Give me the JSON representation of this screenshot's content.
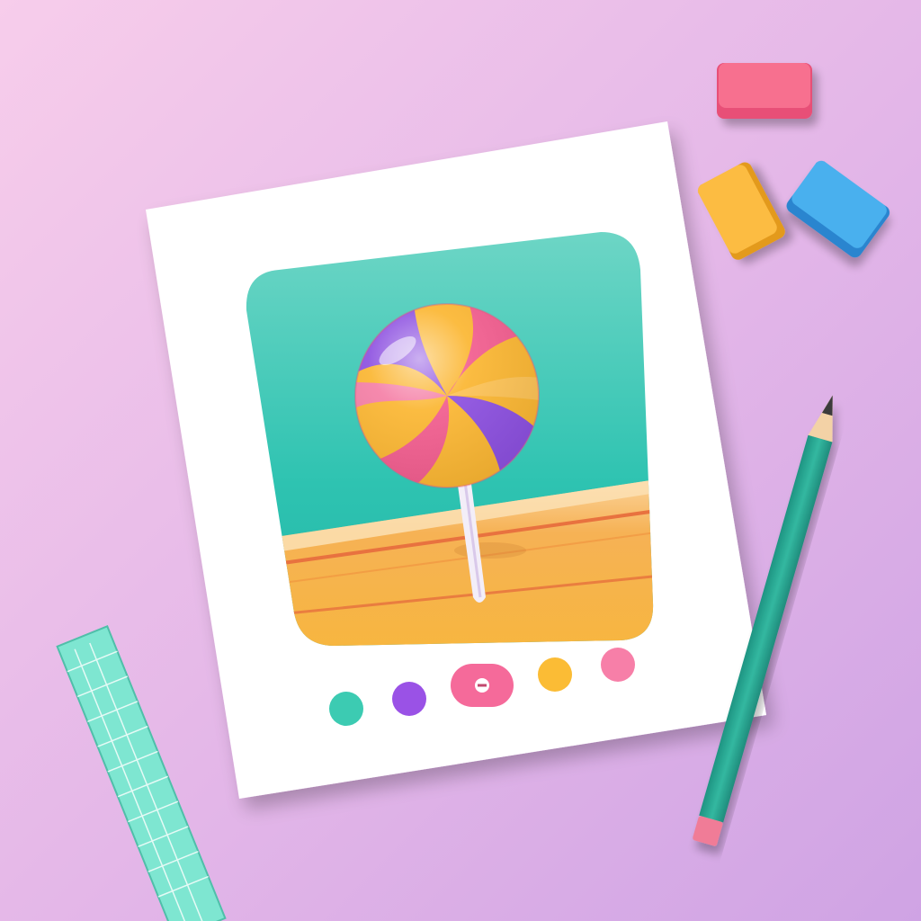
{
  "colors": {
    "background_light": "#F5CBEA",
    "background_dark": "#D3A6E6",
    "paper": "#FFFFFF",
    "card_teal": "#2FC2B0",
    "card_teal_light": "#66D9C6",
    "table_orange": "#F8B24A",
    "table_stripe": "#E6703E",
    "candy_pink": "#F25C8E",
    "candy_yellow": "#FBB631",
    "candy_purple": "#8C4FE0",
    "dot_teal": "#3CCBB2",
    "dot_purple": "#9A52E6",
    "dot_pink": "#F56A9A",
    "dot_yellow": "#FBBC35",
    "dot_light_pink": "#F77FA8",
    "eraser_pink": "#F7678C",
    "eraser_yellow": "#FCB53A",
    "eraser_blue": "#3DA5E9",
    "pencil_teal": "#27A892",
    "ruler_teal": "#6CE3CC"
  },
  "icons": {
    "candy": "lollipop-icon",
    "selected_dot_mark": "minus-icon"
  },
  "carousel": {
    "dot_count": 5,
    "selected_index": 2
  }
}
